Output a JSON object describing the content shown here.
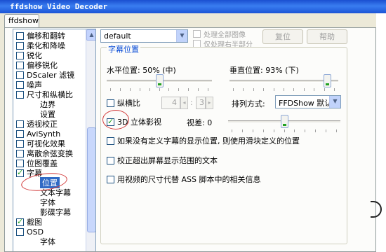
{
  "window": {
    "title": "ffdshow Video Decoder",
    "tab_label": "ffdshow"
  },
  "tree": {
    "items": [
      {
        "label": "偏移和翻转",
        "checked": false
      },
      {
        "label": "柔化和降噪",
        "checked": false
      },
      {
        "label": "锐化",
        "checked": false
      },
      {
        "label": "偏移锐化",
        "checked": false
      },
      {
        "label": "DScaler 滤镜",
        "checked": false
      },
      {
        "label": "噪声",
        "checked": false
      },
      {
        "label": "尺寸和纵横比",
        "checked": false
      },
      {
        "label": "边界"
      },
      {
        "label": "设置"
      },
      {
        "label": "透视校正",
        "checked": false
      },
      {
        "label": "AviSynth",
        "checked": false
      },
      {
        "label": "可视化效果",
        "checked": false
      },
      {
        "label": "离散余弦变换",
        "checked": false
      },
      {
        "label": "位图覆盖",
        "checked": false
      },
      {
        "label": "字幕",
        "checked": true
      },
      {
        "label": "位置",
        "selected": true
      },
      {
        "label": "文本字幕"
      },
      {
        "label": "字体"
      },
      {
        "label": "影碟字幕"
      },
      {
        "label": "截图",
        "checked": true
      },
      {
        "label": "OSD",
        "checked": false
      },
      {
        "label": "字体"
      }
    ]
  },
  "toolbar": {
    "preset_value": "default",
    "process_all_label": "处理全部图像",
    "process_right_label": "仅处理右半部分",
    "reset_label": "复位",
    "help_label": "帮助"
  },
  "subtitle_position": {
    "group_title": "字幕位置",
    "horizontal_label": "水平位置: 50% (中)",
    "horizontal_value_pct": 50,
    "vertical_label": "垂直位置: 93% (下)",
    "vertical_value_pct": 93,
    "aspect_label": "纵横比",
    "aspect_checked": false,
    "aspect_num": "4",
    "aspect_den": "3",
    "aspect_sep": ":",
    "align_label": "排列方式:",
    "align_value": "FFDShow 默认",
    "stereo_label": "3D 立体影视",
    "stereo_checked": true,
    "parallax_label": "视差: 0",
    "parallax_value": 0,
    "option1": "如果没有定义字幕的显示位置, 则使用滑块定义的位置",
    "option2": "校正超出屏幕显示范围的文本",
    "option3": "用视频的尺寸代替 ASS 脚本中的相关信息"
  },
  "colors": {
    "title_bar": "#1a4fd0",
    "selection": "#316ac5",
    "group_title": "#0046d5",
    "annotation": "#d23a3a"
  }
}
